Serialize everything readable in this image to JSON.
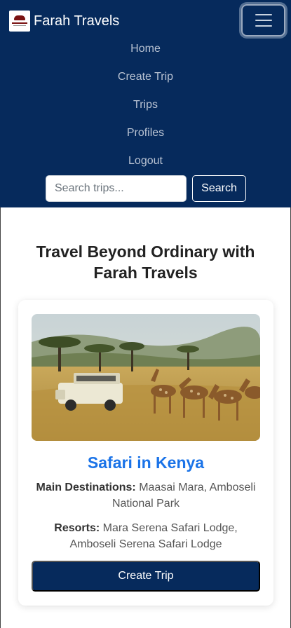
{
  "navbar": {
    "brand": "Farah Travels",
    "links": [
      "Home",
      "Create Trip",
      "Trips",
      "Profiles",
      "Logout"
    ],
    "search": {
      "placeholder": "Search trips...",
      "button": "Search"
    }
  },
  "hero": {
    "title": "Travel Beyond Ordinary with Farah Travels"
  },
  "card": {
    "image_icon": "safari-photo",
    "title": "Safari in Kenya",
    "destinations_label": "Main Destinations:",
    "destinations": " Maasai Mara, Amboseli National Park",
    "resorts_label": "Resorts:",
    "resorts": " Mara Serena Safari Lodge, Amboseli Serena Safari Lodge",
    "cta": "Create Trip"
  },
  "colors": {
    "nav_bg": "#062a5c",
    "link": "#1a73e8",
    "cta_bg": "#062a5c"
  }
}
